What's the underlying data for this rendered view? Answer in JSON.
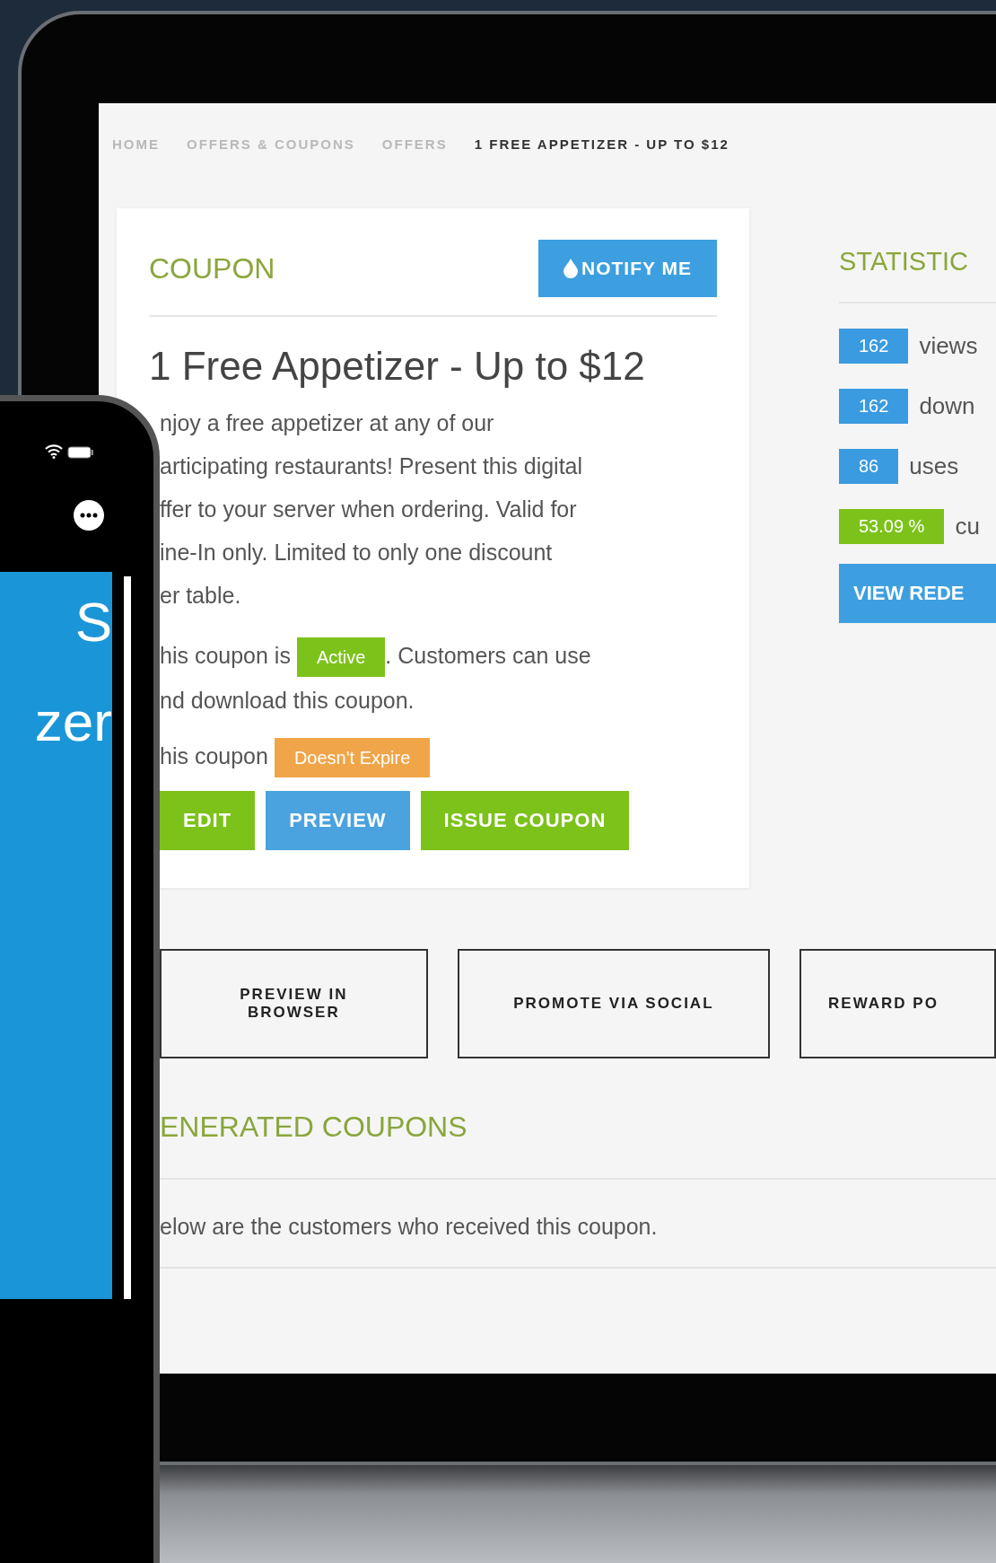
{
  "breadcrumb": [
    {
      "label": "HOME",
      "current": false
    },
    {
      "label": "OFFERS & COUPONS",
      "current": false
    },
    {
      "label": "OFFERS",
      "current": false
    },
    {
      "label": "1 FREE APPETIZER - UP TO $12",
      "current": true
    }
  ],
  "coupon": {
    "heading": "COUPON",
    "notify_button": "NOTIFY ME",
    "title": "1 Free Appetizer - Up to $12",
    "description": "njoy a free appetizer at any of our\narticipating restaurants! Present this digital\nffer to your server when ordering. Valid for\nine-In only. Limited to only one discount\ner table.",
    "status": {
      "prefix": "his coupon is",
      "badge": "Active",
      "suffix": ". Customers can use",
      "continuation": "nd download this coupon."
    },
    "expiry": {
      "prefix": "his coupon",
      "badge": "Doesn't Expire"
    },
    "buttons": [
      {
        "label": "EDIT",
        "color": "#7cc21b"
      },
      {
        "label": "PREVIEW",
        "color": "#4aa3de"
      },
      {
        "label": "ISSUE COUPON",
        "color": "#7cc21b"
      }
    ]
  },
  "statistics": {
    "heading": "STATISTIC",
    "items": [
      {
        "value": "162",
        "label": "views",
        "color": "#3b9be0"
      },
      {
        "value": "162",
        "label": "down",
        "color": "#3b9be0"
      },
      {
        "value": "86",
        "label": "uses",
        "color": "#3b9be0"
      },
      {
        "value": "53.09 %",
        "label": "cu",
        "color": "#7cc21b"
      }
    ],
    "button": "VIEW REDE"
  },
  "actions": [
    {
      "label": "PREVIEW IN BROWSER"
    },
    {
      "label": "PROMOTE VIA SOCIAL"
    },
    {
      "label": "REWARD PO"
    }
  ],
  "generated": {
    "heading": "ENERATED COUPONS",
    "text": "elow are the customers who received this coupon."
  },
  "phone": {
    "ticket_lines": [
      "S",
      "zer"
    ]
  }
}
